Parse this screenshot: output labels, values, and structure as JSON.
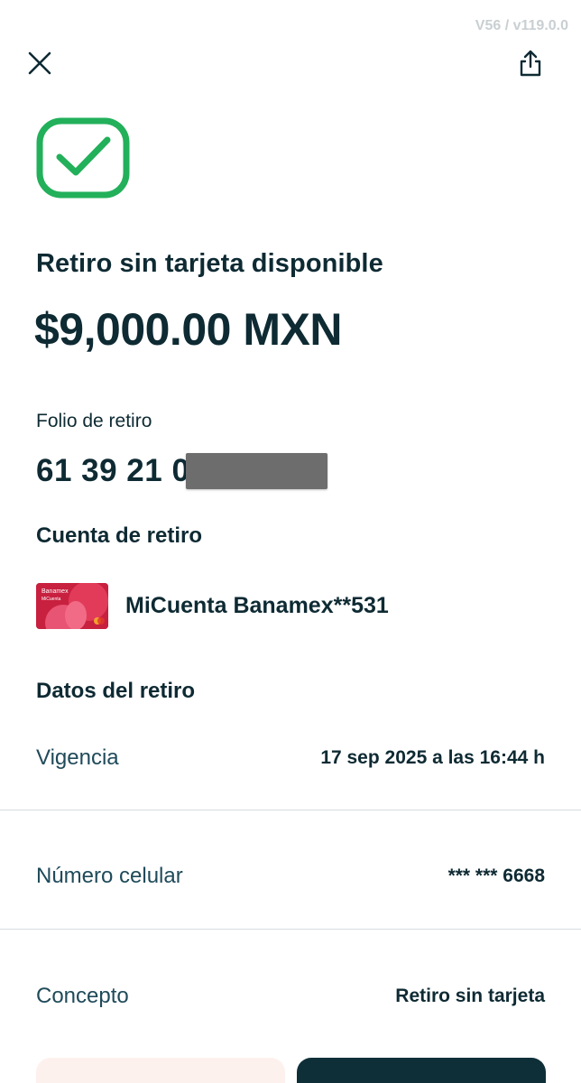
{
  "version_tag": "V56 / v119.0.0",
  "header": {
    "close_icon": "close-icon",
    "share_icon": "share-icon"
  },
  "status": {
    "icon": "check-icon",
    "color": "#22b05a"
  },
  "title": "Retiro sin tarjeta disponible",
  "amount": "$9,000.00 MXN",
  "folio": {
    "label": "Folio de retiro",
    "value": "61 39 21 0"
  },
  "cuenta": {
    "heading": "Cuenta de retiro",
    "card_brand": "Banamex",
    "card_product": "MiCuenta",
    "account_name": "MiCuenta Banamex**531"
  },
  "datos": {
    "heading": "Datos del retiro",
    "rows": [
      {
        "label": "Vigencia",
        "value": "17 sep 2025 a las 16:44 h"
      },
      {
        "label": "Número celular",
        "value": "*** *** 6668"
      },
      {
        "label": "Concepto",
        "value": "Retiro sin tarjeta"
      }
    ]
  },
  "colors": {
    "primary_dark": "#0e2f38",
    "secondary_bg": "#fdf1ee",
    "success_green": "#22b05a"
  }
}
